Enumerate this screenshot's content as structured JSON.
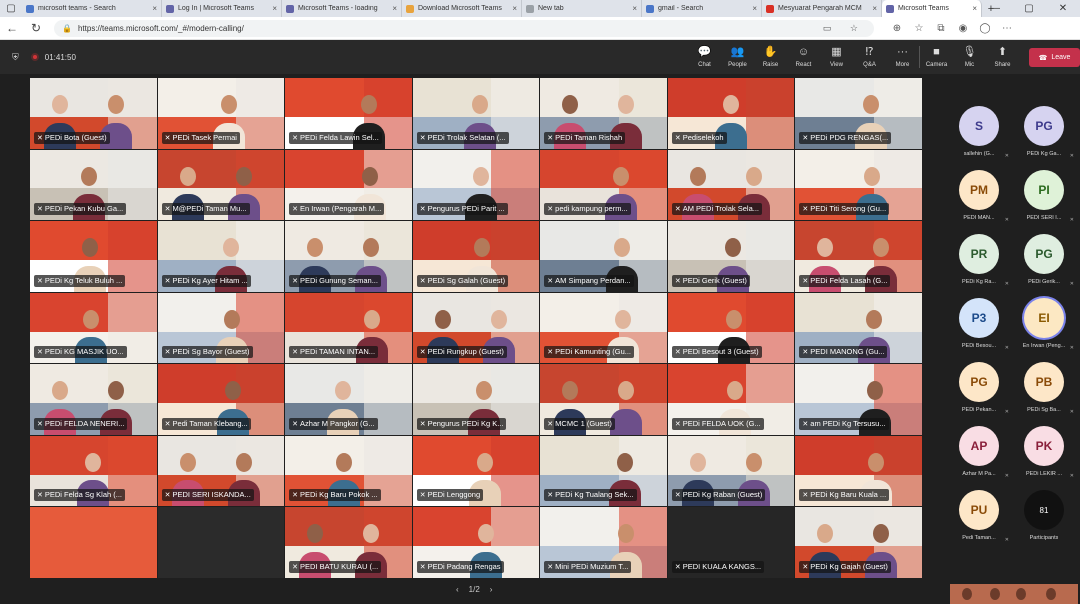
{
  "browser": {
    "tabs": [
      {
        "label": "microsoft teams - Search",
        "color": "#4a76c8"
      },
      {
        "label": "Log In | Microsoft Teams",
        "color": "#6264a7"
      },
      {
        "label": "Microsoft Teams - loading",
        "color": "#6264a7"
      },
      {
        "label": "Download Microsoft Teams",
        "color": "#e8a33d"
      },
      {
        "label": "New tab",
        "color": "#9aa0a6"
      },
      {
        "label": "gmail - Search",
        "color": "#4a76c8"
      },
      {
        "label": "Mesyuarat Pengarah MCM",
        "color": "#d93025"
      },
      {
        "label": "Microsoft Teams",
        "color": "#6264a7"
      }
    ],
    "url": "https://teams.microsoft.com/_#/modern-calling/"
  },
  "meeting": {
    "timer": "01:41:50",
    "toolbar": [
      {
        "label": "Chat",
        "icon": "chat-icon",
        "glyph": "💬"
      },
      {
        "label": "People",
        "icon": "people-icon",
        "glyph": "👥"
      },
      {
        "label": "Raise",
        "icon": "hand-icon",
        "glyph": "✋"
      },
      {
        "label": "React",
        "icon": "smile-icon",
        "glyph": "☺"
      },
      {
        "label": "View",
        "icon": "grid-icon",
        "glyph": "▦"
      },
      {
        "label": "Q&A",
        "icon": "qa-icon",
        "glyph": "⁉"
      },
      {
        "label": "More",
        "icon": "more-icon",
        "glyph": "···"
      }
    ],
    "devices": [
      {
        "label": "Camera",
        "icon": "camera-icon",
        "glyph": "■"
      },
      {
        "label": "Mic",
        "icon": "mic-icon",
        "glyph": "🎙"
      },
      {
        "label": "Share",
        "icon": "share-icon",
        "glyph": "⬆"
      }
    ],
    "leave_label": "Leave",
    "pager": "1/2",
    "tiles": [
      "PEDi Bota (Guest)",
      "PEDi Tasek Permai",
      "PEDi Felda Lawin Sel...",
      "PEDi Trolak Selatan (...",
      "PEDi Taman Rishah",
      "Pediselekoh",
      "PEDi PDG RENGAS(...",
      "PEDi Pekan Kubu Ga...",
      "M@PEDi Taman Mu...",
      "En Irwan (Pengarah M...",
      "Pengurus PEDi Parit ...",
      "pedi kampung perm...",
      "AM PEDi Trolak Sela...",
      "PEDi Titi Serong (Gu...",
      "PEDi Kg Teluk Buluh ...",
      "PEDi Kg Ayer Hitam ...",
      "PEDi Gunung Seman...",
      "PEDi Sg Galah (Guest)",
      "AM Simpang Perdan...",
      "PEDi Gerik (Guest)",
      "PEDi Felda Lasah (G...",
      "PEDi KG MASJIK UO...",
      "PEDi Sg Bayor (Guest)",
      "PEDi TAMAN INTAN...",
      "PEDi Rungkup (Guest)",
      "PEDi Kamunting (Gu...",
      "PEDi Besout 3 (Guest)",
      "PEDI MANONG (Gu...",
      "PEDi FELDA NENERI...",
      "Pedi Taman Klebang...",
      "Azhar M Pangkor (G...",
      "Pengurus PEDi Kg K...",
      "MCMC 1 (Guest)",
      "PEDi FELDA UOK (G...",
      "am PEDi Kg Tersusu...",
      "PEDi Felda Sg Klah (...",
      "PEDI SERI ISKANDA...",
      "PEDi Kg Baru Pokok ...",
      "PEDi Lenggong",
      "PEDi Kg Tualang Sek...",
      "PEDi Kg Raban (Guest)",
      "PEDi Kg Baru Kuala ...",
      "",
      "",
      "PEDI BATU KURAU (...",
      "PEDi Padang Rengas",
      "Mini PEDi Muzium T...",
      "PEDI KUALA KANGS...",
      "PEDi Kg Gajah (Guest)"
    ],
    "people_panel": [
      {
        "initials": "S",
        "name": "sallehin (G...",
        "bg": "#d6d3f0",
        "fg": "#3d3a8c"
      },
      {
        "initials": "PG",
        "name": "PEDi Kg Ga...",
        "bg": "#d6d3f0",
        "fg": "#3d3a8c"
      },
      {
        "initials": "PM",
        "name": "PEDI MAN...",
        "bg": "#fde7c8",
        "fg": "#8a4b08"
      },
      {
        "initials": "PI",
        "name": "PEDI SERI I...",
        "bg": "#dff2d8",
        "fg": "#2b6b1e"
      },
      {
        "initials": "PR",
        "name": "PEDi Kg Ra...",
        "bg": "#dfeee0",
        "fg": "#2b5a2e"
      },
      {
        "initials": "PG",
        "name": "PEDi Gerik...",
        "bg": "#dfeee0",
        "fg": "#2b5a2e"
      },
      {
        "initials": "P3",
        "name": "PEDi Besou...",
        "bg": "#d4e4fa",
        "fg": "#1b4a8a"
      },
      {
        "initials": "EI",
        "name": "En Irwan (Peng...",
        "bg": "#fce8c3",
        "fg": "#8a5a00"
      },
      {
        "initials": "PG",
        "name": "PEDi Pekan...",
        "bg": "#fde7c8",
        "fg": "#8a4b08"
      },
      {
        "initials": "PB",
        "name": "PEDi Sg Ba...",
        "bg": "#fde7c8",
        "fg": "#8a4b08"
      },
      {
        "initials": "AP",
        "name": "Azhar M Pa...",
        "bg": "#f9dde4",
        "fg": "#8a1f3a"
      },
      {
        "initials": "PK",
        "name": "PEDi LEKIR ...",
        "bg": "#f9dde4",
        "fg": "#8a1f3a"
      },
      {
        "initials": "PU",
        "name": "Pedi Taman...",
        "bg": "#fde7c8",
        "fg": "#8a4b08"
      },
      {
        "initials": "81",
        "name": "Participants",
        "bg": "#111111",
        "fg": "#ffffff"
      }
    ]
  }
}
